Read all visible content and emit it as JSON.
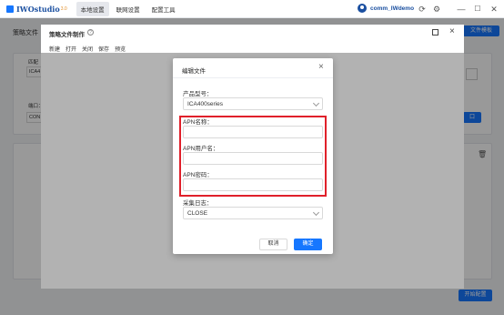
{
  "app": {
    "logo_text": "IWOstudio",
    "logo_version": "3.0",
    "menu": [
      "本地设置",
      "联网设置",
      "配置工具"
    ],
    "user": "comm_IWdemo"
  },
  "page": {
    "strategy_label": "策略文件",
    "top_right_button": "文件模板",
    "match_label": "匹配",
    "match_value": "ICA4",
    "port_label": "端口：",
    "port_value": "CON",
    "right_button": "口",
    "bottom_right_button": "开始配置"
  },
  "outer_modal": {
    "title": "策略文件制作",
    "toolbar": [
      "新建",
      "打开",
      "关闭",
      "保存",
      "预览"
    ]
  },
  "dialog": {
    "title": "编辑文件",
    "product_label": "产品型号：",
    "product_value": "ICA400series",
    "apn_name_label": "APN名称：",
    "apn_user_label": "APN用户名：",
    "apn_pass_label": "APN密码：",
    "log_label": "采集日志：",
    "log_value": "CLOSE",
    "cancel_label": "取消",
    "ok_label": "确定"
  },
  "colors": {
    "accent": "#1677ff",
    "highlight": "#e0202a"
  }
}
